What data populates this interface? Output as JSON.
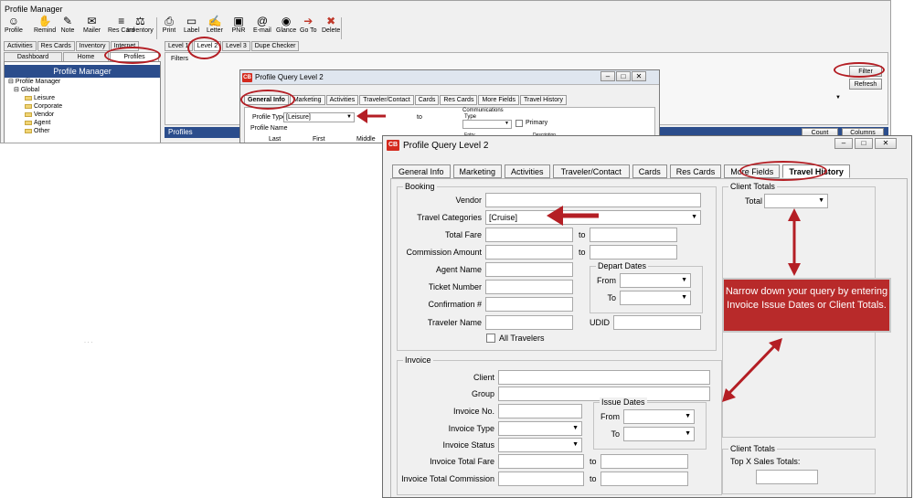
{
  "app": {
    "title": "Profile Manager",
    "toolbar": [
      {
        "label": "Profile",
        "icon": "profile-icon",
        "glyph": "☺",
        "dropdown": true
      },
      {
        "label": "Remind",
        "icon": "remind-icon",
        "glyph": "✋"
      },
      {
        "label": "Note",
        "icon": "note-icon",
        "glyph": "✎"
      },
      {
        "label": "Mailer",
        "icon": "mailer-icon",
        "glyph": "✉"
      },
      {
        "label": "Res Card",
        "icon": "res-card-icon",
        "glyph": "≡"
      },
      {
        "label": "Inventory",
        "icon": "inventory-icon",
        "glyph": "⚖",
        "dropdown": true
      },
      {
        "label": "Print",
        "icon": "print-icon",
        "glyph": "⎙"
      },
      {
        "label": "Label",
        "icon": "label-icon",
        "glyph": "▭"
      },
      {
        "label": "Letter",
        "icon": "letter-icon",
        "glyph": "✍"
      },
      {
        "label": "PNR",
        "icon": "pnr-icon",
        "glyph": "▣"
      },
      {
        "label": "E-mail",
        "icon": "email-icon",
        "glyph": "@"
      },
      {
        "label": "Glance",
        "icon": "glance-icon",
        "glyph": "◉"
      },
      {
        "label": "Go To",
        "icon": "go-to-icon",
        "glyph": "➔"
      },
      {
        "label": "Delete",
        "icon": "delete-icon",
        "glyph": "✖"
      }
    ],
    "left_tabs": [
      "Activities",
      "Res Cards",
      "Inventory",
      "Internet"
    ],
    "left_tabs2": [
      "Dashboard",
      "Home",
      "Profiles"
    ],
    "left_header": "Profile Manager",
    "tree": [
      "Profile Manager",
      "Global",
      "Leisure",
      "Corporate",
      "Vendor",
      "Agent",
      "Other"
    ],
    "right_tabs": [
      "Level 1",
      "Level 2",
      "Level 3",
      "Dupe Checker"
    ],
    "filters_label": "Filters",
    "filter_button": "Filter",
    "refresh_button": "Refresh",
    "profiles_bar": "Profiles",
    "count_label": "Count",
    "columns_label": "Columns"
  },
  "small_dialog": {
    "title": "Profile Query Level 2",
    "logo": "CB",
    "tabs": [
      "General Info",
      "Marketing",
      "Activities",
      "Traveler/Contact",
      "Cards",
      "Res Cards",
      "More Fields",
      "Travel History"
    ],
    "profile_type_label": "Profile Type",
    "profile_type_value": "[Leisure]",
    "to_label": "to",
    "profile_name_label": "Profile Name",
    "last_label": "Last",
    "first_label": "First",
    "middle_label": "Middle",
    "communications_label": "Communications",
    "type_label": "Type",
    "primary_label": "Primary",
    "entry_label": "Entry",
    "description_label": "Description"
  },
  "dialog": {
    "title": "Profile Query Level 2",
    "logo": "CB",
    "tabs": [
      "General Info",
      "Marketing",
      "Activities",
      "Traveler/Contact",
      "Cards",
      "Res Cards",
      "More Fields",
      "Travel History"
    ],
    "booking": {
      "legend": "Booking",
      "vendor": "Vendor",
      "travel_categories": "Travel Categories",
      "travel_categories_value": "[Cruise]",
      "total_fare": "Total Fare",
      "commission_amount": "Commission Amount",
      "to": "to",
      "agent_name": "Agent Name",
      "ticket_number": "Ticket Number",
      "confirmation": "Confirmation #",
      "traveler_name": "Traveler Name",
      "all_travelers": "All Travelers",
      "depart_dates": "Depart Dates",
      "from": "From",
      "to_date": "To",
      "udid": "UDID"
    },
    "client_totals": {
      "legend": "Client Totals",
      "total": "Total"
    },
    "invoice": {
      "legend": "Invoice",
      "client": "Client",
      "group": "Group",
      "invoice_no": "Invoice No.",
      "invoice_type": "Invoice Type",
      "invoice_status": "Invoice Status",
      "invoice_total_fare": "Invoice Total Fare",
      "invoice_total_commission": "Invoice Total Commission",
      "issue_dates": "Issue Dates",
      "from": "From",
      "to_date": "To",
      "to": "to"
    },
    "client_totals2": {
      "legend": "Client Totals",
      "top_x": "Top X Sales Totals:"
    }
  },
  "callout": {
    "text": "Narrow down your query by entering Invoice Issue Dates or Client Totals."
  },
  "colors": {
    "accent_red": "#b41e24",
    "header_blue": "#2b4d8c"
  }
}
